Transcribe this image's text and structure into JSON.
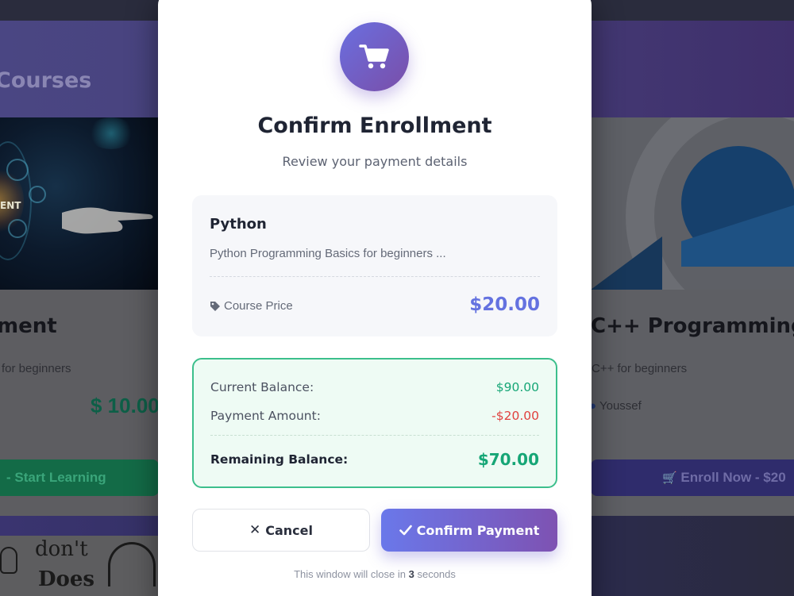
{
  "background": {
    "heading": "Courses",
    "left_card": {
      "title": "ment",
      "description": "for beginners",
      "price": "$ 10.00",
      "button_label": "- Start Learning",
      "image_text": "ENT"
    },
    "right_card": {
      "title": "C++ Programming",
      "description": "C++ for beginners",
      "author": "Youssef",
      "button_label": "Enroll Now - $20"
    },
    "sketch_words": [
      "don't",
      "Does"
    ]
  },
  "modal": {
    "icon": "shopping-cart-icon",
    "title": "Confirm Enrollment",
    "subtitle": "Review your payment details",
    "course": {
      "name": "Python",
      "description": "Python Programming Basics for beginners ...",
      "price_label": "Course Price",
      "price_icon": "tag-icon",
      "price": "$20.00"
    },
    "balance": {
      "current_label": "Current Balance:",
      "current_value": "$90.00",
      "payment_label": "Payment Amount:",
      "payment_value": "-$20.00",
      "remaining_label": "Remaining Balance:",
      "remaining_value": "$70.00"
    },
    "buttons": {
      "cancel_label": "Cancel",
      "cancel_icon": "close-icon",
      "confirm_label": "Confirm Payment",
      "confirm_icon": "check-icon"
    },
    "countdown": {
      "prefix": "This window will close in",
      "seconds": "3",
      "suffix": "seconds"
    }
  },
  "colors": {
    "accent": "#6472e0",
    "accent_gradient_end": "#7e52b2",
    "success": "#16a676",
    "danger": "#e0413e",
    "balance_border": "#3cbf8c"
  }
}
